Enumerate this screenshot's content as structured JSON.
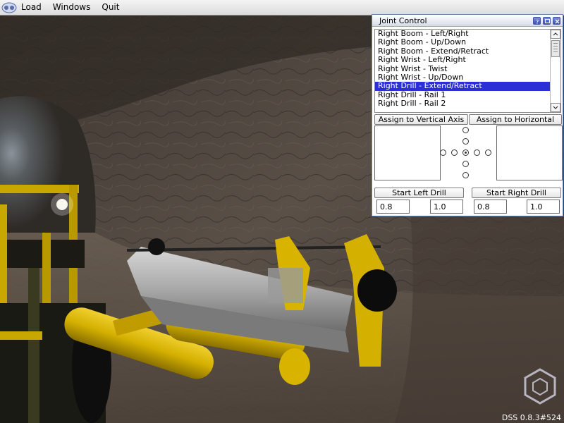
{
  "menubar": {
    "items": [
      "Load",
      "Windows",
      "Quit"
    ]
  },
  "joint_control": {
    "title": "Joint Control",
    "joints": [
      "Right Boom - Left/Right",
      "Right Boom - Up/Down",
      "Right Boom - Extend/Retract",
      "Right Wrist - Left/Right",
      "Right Wrist - Twist",
      "Right Wrist - Up/Down",
      "Right Drill - Extend/Retract",
      "Right Drill - Rail 1",
      "Right Drill - Rail 2"
    ],
    "selected_index": 6,
    "assign_vertical_label": "Assign to Vertical Axis",
    "assign_horizontal_label": "Assign to Horizontal Axis",
    "start_left_drill_label": "Start Left Drill",
    "start_right_drill_label": "Start Right Drill",
    "left_drill_values": [
      "0.8",
      "1.0"
    ],
    "right_drill_values": [
      "0.8",
      "1.0"
    ]
  },
  "status": {
    "version": "DSS 0.8.3#524"
  },
  "colors": {
    "selection": "#2b2fd6",
    "machine_yellow": "#d8b400",
    "drill_gray": "#b4b4b4",
    "rock": "#4a423a"
  }
}
